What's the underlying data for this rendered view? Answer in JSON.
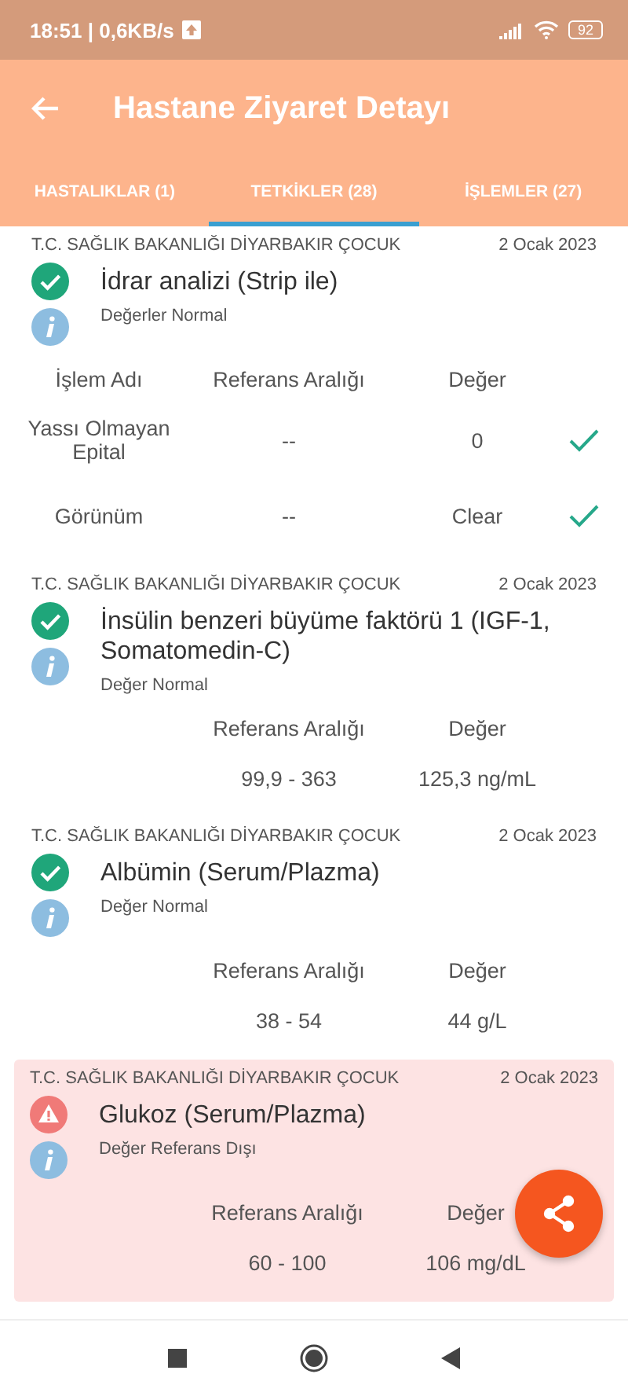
{
  "status_bar": {
    "time": "18:51 | 0,6KB/s",
    "battery": "92"
  },
  "app_bar": {
    "title": "Hastane Ziyaret Detayı"
  },
  "tabs": [
    {
      "label": "HASTALIKLAR (1)",
      "selected": false
    },
    {
      "label": "TETKİKLER (28)",
      "selected": true
    },
    {
      "label": "İŞLEMLER (27)",
      "selected": false
    }
  ],
  "tests": [
    {
      "hospital": "T.C. SAĞLIK BAKANLIĞI DİYARBAKIR ÇOCUK",
      "date": "2 Ocak 2023",
      "kind": "normal",
      "title": "İdrar analizi (Strip ile)",
      "note": "Değerler Normal",
      "table": {
        "columns": [
          {
            "kind": "name",
            "label": "İşlem Adı"
          },
          {
            "kind": "range",
            "label": "Referans Aralığı"
          },
          {
            "kind": "value",
            "label": "Değer"
          }
        ],
        "rows": [
          {
            "cells": [
              "Yassı Olmayan Epital",
              "--",
              "0"
            ],
            "checked": true
          },
          {
            "cells": [
              "Görünüm",
              "--",
              "Clear"
            ],
            "checked": true
          }
        ]
      }
    },
    {
      "hospital": "T.C. SAĞLIK BAKANLIĞI DİYARBAKIR ÇOCUK",
      "date": "2 Ocak 2023",
      "kind": "normal",
      "title": "İnsülin benzeri büyüme faktörü 1 (IGF-1, Somatomedin-C)",
      "note": "Değer Normal",
      "table": {
        "columns": [
          {
            "kind": "range",
            "label": "Referans Aralığı"
          },
          {
            "kind": "value",
            "label": "Değer"
          }
        ],
        "rows": [
          {
            "cells": [
              "99,9 - 363",
              "125,3 ng/mL"
            ]
          }
        ]
      }
    },
    {
      "hospital": "T.C. SAĞLIK BAKANLIĞI DİYARBAKIR ÇOCUK",
      "date": "2 Ocak 2023",
      "kind": "normal",
      "title": "Albümin (Serum/Plazma)",
      "note": "Değer Normal",
      "table": {
        "columns": [
          {
            "kind": "range",
            "label": "Referans Aralığı"
          },
          {
            "kind": "value",
            "label": "Değer"
          }
        ],
        "rows": [
          {
            "cells": [
              "38 - 54",
              "44 g/L"
            ]
          }
        ]
      }
    },
    {
      "hospital": "T.C. SAĞLIK BAKANLIĞI DİYARBAKIR ÇOCUK",
      "date": "2 Ocak 2023",
      "kind": "alert",
      "title": "Glukoz (Serum/Plazma)",
      "note": "Değer Referans Dışı",
      "table": {
        "columns": [
          {
            "kind": "range",
            "label": "Referans Aralığı"
          },
          {
            "kind": "value",
            "label": "Değer"
          }
        ],
        "rows": [
          {
            "cells": [
              "60 - 100",
              "106 mg/dL"
            ]
          }
        ]
      }
    }
  ]
}
